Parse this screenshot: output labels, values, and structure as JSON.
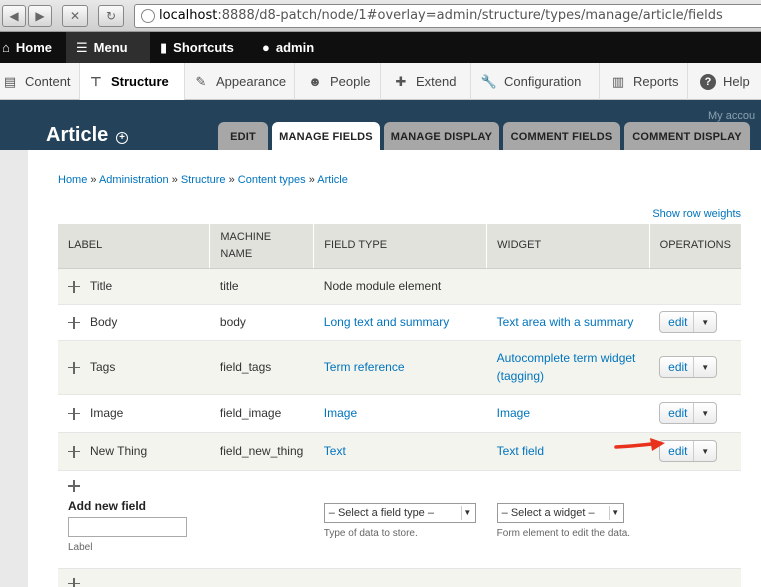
{
  "browser": {
    "url_host": "localhost",
    "url_rest": ":8888/d8-patch/node/1#overlay=admin/structure/types/manage/article/fields"
  },
  "toolbar": {
    "home": "Home",
    "menu": "Menu",
    "shortcuts": "Shortcuts",
    "user": "admin"
  },
  "tray": {
    "content": "Content",
    "structure": "Structure",
    "appearance": "Appearance",
    "people": "People",
    "extend": "Extend",
    "configuration": "Configuration",
    "reports": "Reports",
    "help": "Help"
  },
  "background": {
    "my_account": "My accou"
  },
  "page": {
    "title": "Article"
  },
  "tabs": [
    {
      "label": "Edit"
    },
    {
      "label": "Manage fields"
    },
    {
      "label": "Manage display"
    },
    {
      "label": "Comment fields"
    },
    {
      "label": "Comment display"
    }
  ],
  "breadcrumb": {
    "home": "Home",
    "administration": "Administration",
    "structure": "Structure",
    "content_types": "Content types",
    "article": "Article",
    "sep": " » "
  },
  "show_row_weights": "Show row weights",
  "table": {
    "headers": {
      "label": "Label",
      "machine_name": "Machine name",
      "field_type": "Field type",
      "widget": "Widget",
      "operations": "Operations"
    },
    "rows": [
      {
        "label": "Title",
        "machine": "title",
        "type": "Node module element",
        "widget": "",
        "op": ""
      },
      {
        "label": "Body",
        "machine": "body",
        "type": "Long text and summary",
        "widget": "Text area with a summary",
        "op": "edit"
      },
      {
        "label": "Tags",
        "machine": "field_tags",
        "type": "Term reference",
        "widget_line1": "Autocomplete term widget",
        "widget_line2": "(tagging)",
        "op": "edit"
      },
      {
        "label": "Image",
        "machine": "field_image",
        "type": "Image",
        "widget": "Image",
        "op": "edit"
      },
      {
        "label": "New Thing",
        "machine": "field_new_thing",
        "type": "Text",
        "widget": "Text field",
        "op": "edit"
      }
    ]
  },
  "add_field": {
    "heading": "Add new field",
    "label_desc": "Label",
    "type_select": "– Select a field type –",
    "type_desc": "Type of data to store.",
    "widget_select": "– Select a widget –",
    "widget_desc": "Form element to edit the data."
  },
  "colors": {
    "link": "#0074bd",
    "arrow": "#e8321b",
    "toolbar_bg": "#0f0f0f",
    "header_bg": "#e1e2dc"
  }
}
